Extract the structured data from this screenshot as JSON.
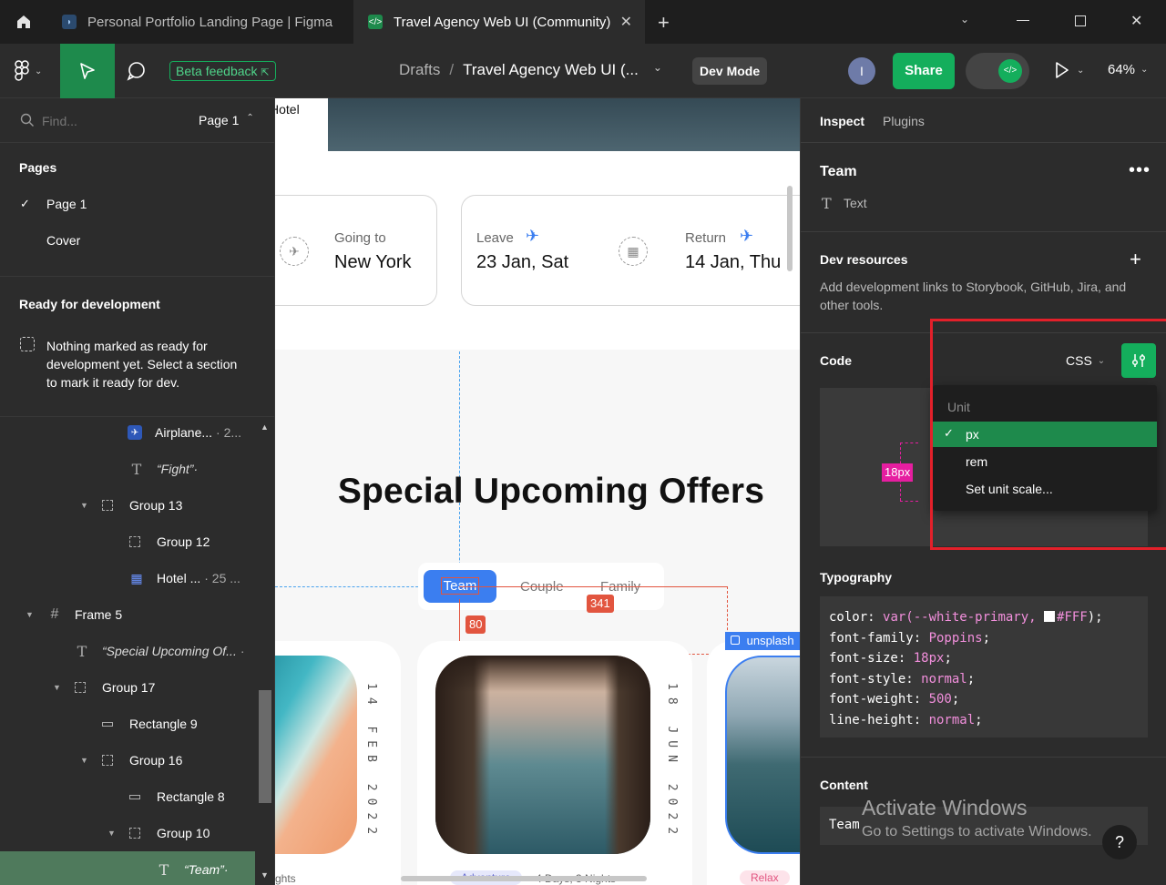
{
  "titlebar": {
    "tabs": [
      {
        "label": "Personal Portfolio Landing Page | Figma U"
      },
      {
        "label": "Travel Agency Web UI (Community)"
      }
    ]
  },
  "toolbar": {
    "beta_feedback": "Beta feedback",
    "breadcrumb_root": "Drafts",
    "breadcrumb_sep": "/",
    "file_name": "Travel Agency Web UI (...",
    "dev_mode": "Dev Mode",
    "avatar_initial": "I",
    "share": "Share",
    "zoom": "64%"
  },
  "left": {
    "search_placeholder": "Find...",
    "page_selector": "Page 1",
    "pages_heading": "Pages",
    "pages": [
      "Page 1",
      "Cover"
    ],
    "ready_heading": "Ready for development",
    "ready_text": "Nothing marked as ready for development yet. Select a section to mark it ready for dev.",
    "layers": [
      {
        "label": "Airplane...",
        "meta": "· 2..."
      },
      {
        "label": "“Fight”·"
      },
      {
        "label": "Group 13"
      },
      {
        "label": "Group 12"
      },
      {
        "label": "Hotel ...",
        "meta": "· 25 ..."
      },
      {
        "label": "Frame 5"
      },
      {
        "label": "“Special Upcoming Of...",
        "meta": "·"
      },
      {
        "label": "Group 17"
      },
      {
        "label": "Rectangle 9"
      },
      {
        "label": "Group 16"
      },
      {
        "label": "Rectangle 8"
      },
      {
        "label": "Group 10"
      },
      {
        "label": "“Team”·"
      }
    ]
  },
  "canvas": {
    "hotel_label": "Hotel",
    "going_to_label": "Going to",
    "going_to_value": "New York",
    "leave_label": "Leave",
    "leave_value": "23 Jan, Sat",
    "return_label": "Return",
    "return_value": "14 Jan, Thu",
    "heading": "Special Upcoming Offers",
    "tabs": [
      "Team",
      "Couple",
      "Family"
    ],
    "measure_80": "80",
    "measure_341": "341",
    "unsplash_tag": "unsplash",
    "date_1": "14 FEB 2022",
    "date_2": "18 JUN 2022",
    "card1_caption": "ghts",
    "card2_tag": "Adventure",
    "card2_caption": "4 Days, 3 Nights",
    "card3_tag": "Relax"
  },
  "right": {
    "tab_inspect": "Inspect",
    "tab_plugins": "Plugins",
    "layer_name": "Team",
    "layer_type": "Text",
    "dev_resources_heading": "Dev resources",
    "dev_resources_text": "Add development links to Storybook, GitHub, Jira, and other tools.",
    "code_heading": "Code",
    "code_lang": "CSS",
    "dropdown_heading": "Unit",
    "dropdown_options": [
      "px",
      "rem",
      "Set unit scale..."
    ],
    "dropdown_selected": "px",
    "size_badge": "18px",
    "typography_heading": "Typography",
    "css_lines": [
      {
        "prop": "color",
        "value": "var(--white-primary, ",
        "value2": "#FFF",
        "tail": ");"
      },
      {
        "prop": "font-family",
        "value": "Poppins",
        "tail": ";"
      },
      {
        "prop": "font-size",
        "value": "18px",
        "tail": ";"
      },
      {
        "prop": "font-style",
        "value": "normal",
        "tail": ";"
      },
      {
        "prop": "font-weight",
        "value": "500",
        "tail": ";"
      },
      {
        "prop": "line-height",
        "value": "normal",
        "tail": ";"
      }
    ],
    "content_heading": "Content",
    "content_value": "Team"
  },
  "watermark": {
    "line1": "Activate Windows",
    "line2": "Go to Settings to activate Windows."
  },
  "help": "?",
  "colors": {
    "accent_green": "#14ae5c",
    "figma_green": "#1e8a4c",
    "highlight_red": "#e3202a",
    "measure_red": "#e2553f",
    "blue": "#3b7ef0",
    "pink": "#e61ea0"
  }
}
